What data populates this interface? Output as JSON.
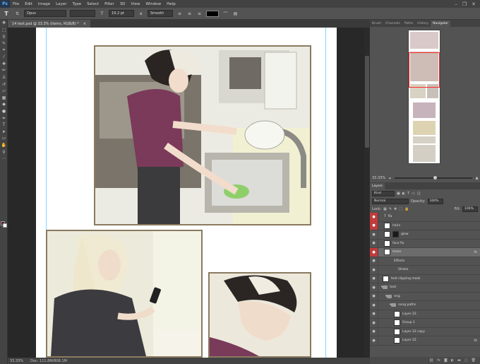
{
  "app": {
    "logo": "Ps"
  },
  "menu": [
    "File",
    "Edit",
    "Image",
    "Layer",
    "Type",
    "Select",
    "Filter",
    "3D",
    "View",
    "Window",
    "Help"
  ],
  "window_controls": {
    "minimize": "–",
    "restore": "❐",
    "close": "✕"
  },
  "options_bar": {
    "tool_glyph": "T",
    "font_family": "Opus",
    "font_style": "",
    "font_size": "19.2 pt",
    "antialias": "Smooth",
    "color": "#000000"
  },
  "document": {
    "tab_title": "14 text.psd @ 33.3% (items, RGB/8) *",
    "tab_close": "×"
  },
  "status": {
    "zoom": "33.33%",
    "doc_size": "Doc: 111.8M/808.1M"
  },
  "panels": {
    "top_tabs": [
      "Brush",
      "Channels",
      "Paths",
      "History",
      "Navigator"
    ],
    "active_top_tab": "Navigator",
    "navigator_zoom": "33.33%",
    "layers_tab": "Layers"
  },
  "layers_controls": {
    "filter_kind": "Kind",
    "blend_mode": "Normal",
    "opacity_label": "Opacity:",
    "opacity_value": "100%",
    "lock_label": "Lock:",
    "fill_label": "Fill:",
    "fill_value": "100%"
  },
  "layers": [
    {
      "name": "fla",
      "type": "text",
      "eye": "red"
    },
    {
      "name": "hairs",
      "type": "layer",
      "eye": "red"
    },
    {
      "name": "glow",
      "type": "layer",
      "eye": "normal"
    },
    {
      "name": "face fix",
      "type": "layer",
      "eye": "normal"
    },
    {
      "name": "items",
      "type": "layer",
      "eye": "red",
      "selected": true,
      "fx": "fx"
    },
    {
      "name": "Effects",
      "type": "effect",
      "eye": "normal"
    },
    {
      "name": "Stroke",
      "type": "effect",
      "eye": "normal"
    },
    {
      "name": "text clipping mask",
      "type": "layer",
      "eye": "normal"
    },
    {
      "name": "text",
      "type": "folder",
      "eye": "normal"
    },
    {
      "name": "eng",
      "type": "folder",
      "eye": "normal"
    },
    {
      "name": "song paths",
      "type": "folder",
      "eye": "normal"
    },
    {
      "name": "Layer 22",
      "type": "layer",
      "eye": "normal"
    },
    {
      "name": "Group 1",
      "type": "folder",
      "eye": "normal"
    },
    {
      "name": "Layer 22 copy",
      "type": "layer",
      "eye": "normal"
    },
    {
      "name": "Layer 22",
      "type": "layer",
      "eye": "normal",
      "fx": "fx"
    }
  ],
  "layers_footer_icons": [
    "link",
    "fx",
    "mask",
    "adjust",
    "folder",
    "new",
    "trash"
  ],
  "colors": {
    "foreground": "#5a2230",
    "background": "#ffffff",
    "accent_red": "#c23b3b",
    "guide": "#7fd8ff"
  }
}
